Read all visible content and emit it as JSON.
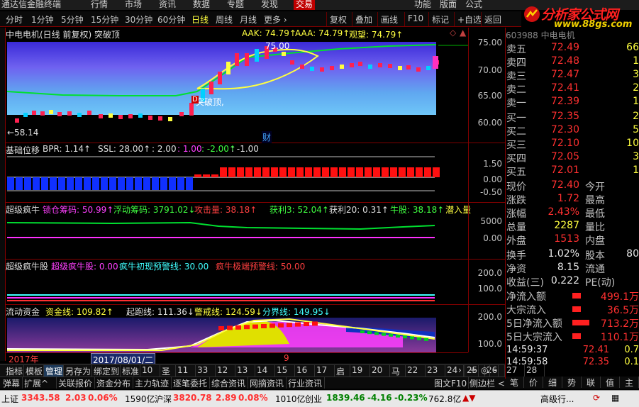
{
  "menu": [
    "通达信金融终端",
    "行情",
    "市场",
    "资讯",
    "数据",
    "专题",
    "发现",
    "交易",
    "功能",
    "版面",
    "公式"
  ],
  "logo": {
    "title": "分析家公式网",
    "url": "www.88gs.com"
  },
  "periods": [
    "分时",
    "1分钟",
    "5分钟",
    "15分钟",
    "30分钟",
    "60分钟",
    "日线",
    "周线",
    "月线",
    "更多 ›"
  ],
  "active_period": "日线",
  "toolbar_right": [
    "复权",
    "叠加",
    "画线",
    "F10",
    "标记",
    "+自选",
    "返回"
  ],
  "stock_code": "603988 中电电机",
  "main_chart": {
    "title": "中电电机(日线 前复权) 突破顶",
    "aak": "AAK: 74.79↑",
    "aaa": "AAA: 74.79↑",
    "watch": "观望: 74.79↑",
    "high_label": "75.00",
    "low_label": "←58.14",
    "annotation": "突破顶,",
    "marker": "财",
    "tag": "D",
    "axis": [
      "75.00",
      "70.00",
      "65.00",
      "60.00"
    ]
  },
  "panel1": {
    "name": "基础位移",
    "bpr": "BPR: 1.14↑",
    "ssl": "SSL: 28.00↑",
    "v1": ": 2.00",
    ":v2": "",
    "v2": ": 1.00",
    "v3": ": -2.00↑",
    "v4": ": -1.00",
    "axis": [
      "1.50",
      "0.00",
      "-0.50"
    ]
  },
  "panel2": {
    "name": "超级疯牛",
    "lock": "锁仓筹码: 50.99↑",
    "float": "浮动筹码: 3791.02↓",
    "attack": "攻击量: 38.18↑",
    "profit3": "获利3: 52.04↑",
    "profit20": "获利20: 0.31↑",
    "bull": "牛股: 38.18↑",
    "enter": "潜入量",
    "axis": [
      "5000",
      "0.00"
    ]
  },
  "panel3": {
    "name": "超级疯牛股",
    "s1": "超级疯牛股: 0.00",
    "s2": "疯牛初现预警线: 30.00",
    "s3": "疯牛极端预警线: 50.00",
    "axis": [
      "200.0",
      "100.0"
    ]
  },
  "panel4": {
    "name": "流动资金",
    "fund": "资金线: 109.82↑",
    "run": "起跑线: 111.36↓",
    "warn": "警戒线: 124.59↓",
    "bound": "分界线: 149.95↓",
    "axis": [
      "200.0",
      "100.0"
    ]
  },
  "datebar": {
    "year": "2017年",
    "date": "2017/08/01/二",
    "mid": "9"
  },
  "bottom_tabs": [
    "指标",
    "模板",
    "管理",
    "另存为",
    "绑定到",
    "标准",
    "10",
    "圣",
    "11",
    "33",
    "12",
    "13",
    "14",
    "15",
    "16",
    "17",
    "启",
    "19",
    "20",
    "马",
    "22",
    "23",
    "24",
    "25",
    "26",
    "27",
    "28"
  ],
  "active_bottom_tab": "管理",
  "func_tabs": [
    "弹幕",
    "扩展^",
    "关联报价",
    "资金分布",
    "主力轨迹",
    "逐笔委托",
    "综合资讯",
    "网摘资讯",
    "行业资讯"
  ],
  "func_right": [
    "图文F10",
    "侧边栏 <"
  ],
  "right_tabs": [
    "笔",
    "价",
    "细",
    "势",
    "联",
    "值",
    "主"
  ],
  "quote": {
    "header": "委比  +4.2%  委差",
    "sell": [
      [
        "卖五",
        "72.49",
        "66"
      ],
      [
        "卖四",
        "72.48",
        "1"
      ],
      [
        "卖三",
        "72.47",
        "3"
      ],
      [
        "卖二",
        "72.41",
        "2"
      ],
      [
        "卖一",
        "72.39",
        "1"
      ]
    ],
    "buy": [
      [
        "买一",
        "72.35",
        "2"
      ],
      [
        "买二",
        "72.30",
        "5"
      ],
      [
        "买三",
        "72.10",
        "10"
      ],
      [
        "买四",
        "72.05",
        "3"
      ],
      [
        "买五",
        "72.01",
        "1"
      ]
    ],
    "stats": [
      [
        "现价",
        "72.40",
        "今开",
        ""
      ],
      [
        "涨跌",
        "1.72",
        "最高",
        ""
      ],
      [
        "涨幅",
        "2.43%",
        "最低",
        ""
      ],
      [
        "总量",
        "2287",
        "量比",
        ""
      ],
      [
        "外盘",
        "1513",
        "内盘",
        ""
      ]
    ],
    "stats2": [
      [
        "换手",
        "1.02%",
        "股本",
        "80"
      ],
      [
        "净资",
        "8.15",
        "流通",
        ""
      ],
      [
        "收益(三)",
        "0.222",
        "PE(动)",
        ""
      ]
    ],
    "flow": [
      [
        "净流入额",
        "499.1万"
      ],
      [
        "大宗流入",
        "36.5万"
      ],
      [
        "5日净流入额",
        "713.2万"
      ],
      [
        "5日大宗流入",
        "110.1万"
      ]
    ],
    "ticks": [
      [
        "14:59:37",
        "72.41",
        "0.7"
      ],
      [
        "14:59:58",
        "72.35",
        "0.1"
      ]
    ]
  },
  "status": {
    "sh_name": "上证",
    "sh": "3343.58",
    "sh_chg": "2.03",
    "sh_pct": "0.06%",
    "sh_amt": "1590亿",
    "sz_name": "沪深",
    "sz": "3820.78",
    "sz_chg": "2.89",
    "sz_pct": "0.08%",
    "sz_amt": "1010亿",
    "cy_name": "创业",
    "cy": "1839.46",
    "cy_chg": "-4.16",
    "cy_pct": "-0.23%",
    "cy_amt": "762.8亿",
    "right": "高级行..."
  }
}
